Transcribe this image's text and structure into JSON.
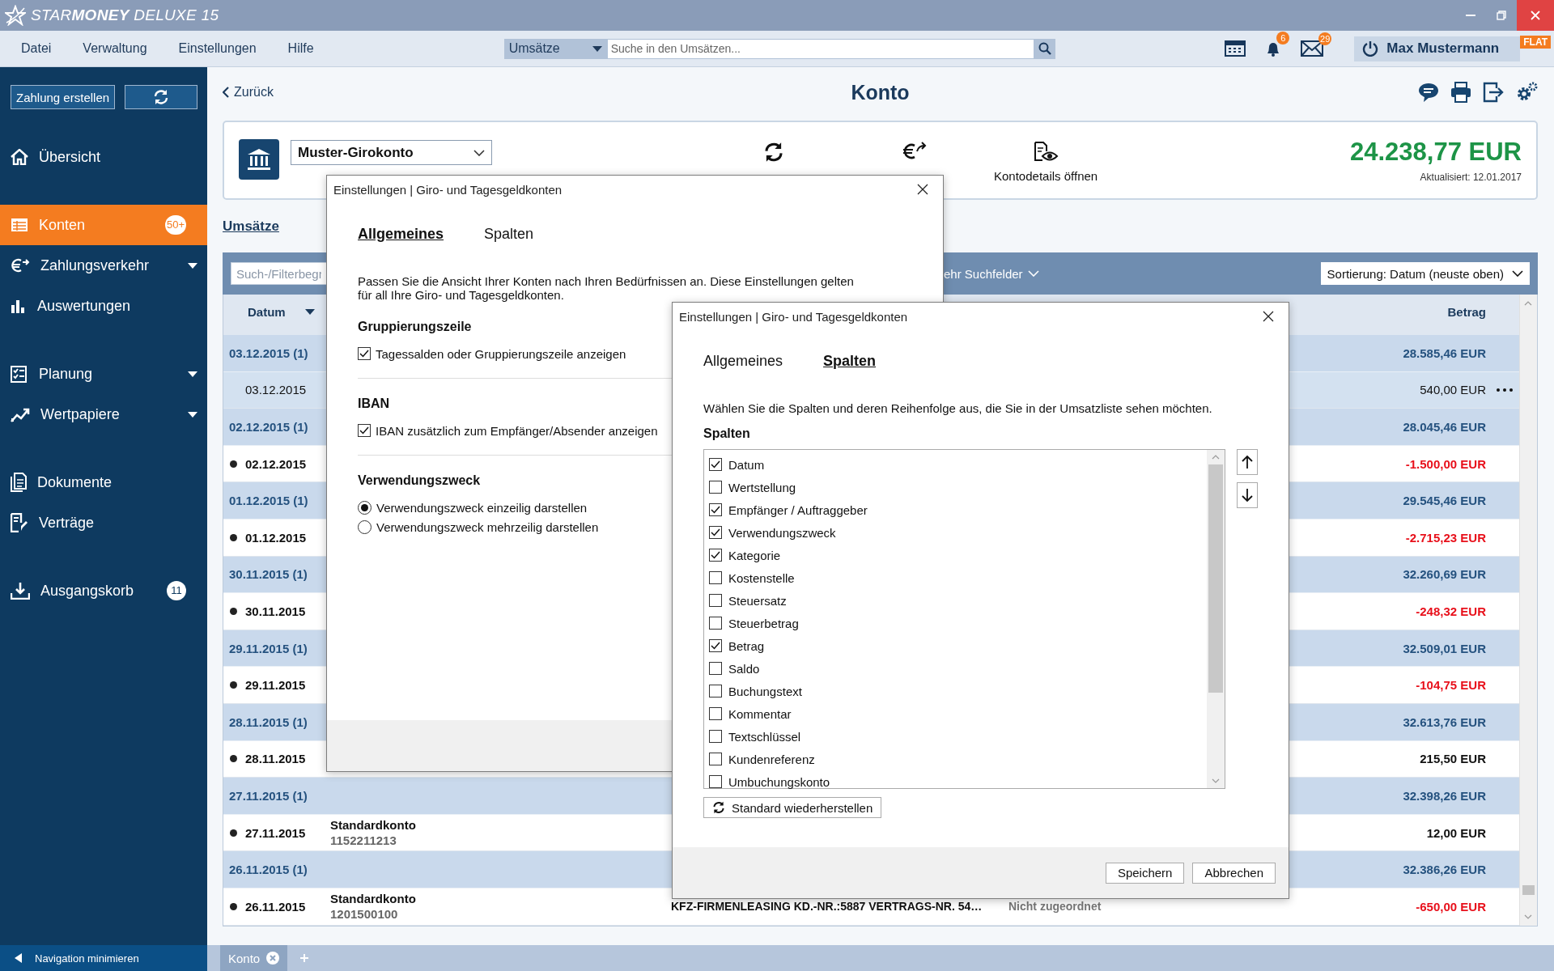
{
  "window": {
    "title": "STAR**MONEY** DELUXE 15"
  },
  "menu": [
    "Datei",
    "Verwaltung",
    "Einstellungen",
    "Hilfe"
  ],
  "search": {
    "scope": "Umsätze",
    "placeholder": "Suche in den Umsätzen..."
  },
  "notifications": {
    "count": "6"
  },
  "messages": {
    "count": "29"
  },
  "user": {
    "name": "Max Mustermann",
    "badge": "FLAT"
  },
  "sidebar": {
    "create_button": "Zahlung erstellen",
    "groups": [
      {
        "items": [
          {
            "label": "Übersicht",
            "selected": false,
            "expandable": false
          }
        ]
      },
      {
        "items": [
          {
            "label": "Konten",
            "selected": true,
            "expandable": false,
            "badge": "50+"
          },
          {
            "label": "Zahlungsverkehr",
            "selected": false,
            "expandable": true
          },
          {
            "label": "Auswertungen",
            "selected": false,
            "expandable": false
          }
        ]
      },
      {
        "items": [
          {
            "label": "Planung",
            "selected": false,
            "expandable": true
          },
          {
            "label": "Wertpapiere",
            "selected": false,
            "expandable": true
          }
        ]
      },
      {
        "items": [
          {
            "label": "Dokumente",
            "selected": false,
            "expandable": false
          },
          {
            "label": "Verträge",
            "selected": false,
            "expandable": false
          }
        ]
      },
      {
        "items": [
          {
            "label": "Ausgangskorb",
            "selected": false,
            "expandable": false,
            "badge": "11"
          }
        ]
      }
    ],
    "footer": "Navigation minimieren"
  },
  "page": {
    "back": "Zurück",
    "title": "Konto"
  },
  "account": {
    "name": "Muster-Girokonto",
    "action": "Kontodetails öffnen",
    "balance": "24.238,77 EUR",
    "updated": "Aktualisiert: 12.01.2017"
  },
  "tabs": [
    {
      "label": "Umsätze",
      "selected": true
    }
  ],
  "filter": {
    "placeholder": "Such-/Filterbegr",
    "more": "ehr Suchfelder",
    "sort": "Sortierung: Datum (neuste oben)"
  },
  "table": {
    "columns": [
      "Datum",
      "Betrag"
    ],
    "rows": [
      {
        "kind": "group",
        "label": "03.12.2015 (1)",
        "amount": "28.585,46 EUR"
      },
      {
        "kind": "item",
        "date": "03.12.2015",
        "amount": "540,00 EUR",
        "negative": false,
        "unread": false,
        "selected": true
      },
      {
        "kind": "group",
        "label": "02.12.2015 (1)",
        "amount": "28.045,46 EUR"
      },
      {
        "kind": "item",
        "date": "02.12.2015",
        "amount": "-1.500,00 EUR",
        "negative": true,
        "unread": true,
        "selected": false
      },
      {
        "kind": "group",
        "label": "01.12.2015 (1)",
        "amount": "29.545,46 EUR"
      },
      {
        "kind": "item",
        "date": "01.12.2015",
        "amount": "-2.715,23 EUR",
        "negative": true,
        "unread": true,
        "selected": false
      },
      {
        "kind": "group",
        "label": "30.11.2015 (1)",
        "amount": "32.260,69 EUR"
      },
      {
        "kind": "item",
        "date": "30.11.2015",
        "amount": "-248,32 EUR",
        "negative": true,
        "unread": true,
        "selected": false
      },
      {
        "kind": "group",
        "label": "29.11.2015 (1)",
        "amount": "32.509,01 EUR"
      },
      {
        "kind": "item",
        "date": "29.11.2015",
        "amount": "-104,75 EUR",
        "negative": true,
        "unread": true,
        "selected": false
      },
      {
        "kind": "group",
        "label": "28.11.2015 (1)",
        "amount": "32.613,76 EUR"
      },
      {
        "kind": "item",
        "date": "28.11.2015",
        "amount": "215,50 EUR",
        "negative": false,
        "unread": true,
        "selected": false
      },
      {
        "kind": "group",
        "label": "27.11.2015 (1)",
        "amount": "32.398,26 EUR"
      },
      {
        "kind": "item",
        "date": "27.11.2015",
        "account": "Standardkonto",
        "account_number": "1152211213",
        "amount": "12,00 EUR",
        "negative": false,
        "unread": true,
        "selected": false
      },
      {
        "kind": "group",
        "label": "26.11.2015 (1)",
        "amount": "32.386,26 EUR"
      },
      {
        "kind": "item",
        "date": "26.11.2015",
        "account": "Standardkonto",
        "account_number": "1201500100",
        "purpose": "KFZ-FIRMENLEASING KD.-NR.:5887 VERTRAGS-NR. 54…",
        "category": "Nicht zugeordnet",
        "amount": "-650,00 EUR",
        "negative": true,
        "unread": true,
        "selected": false
      }
    ]
  },
  "dialogs": [
    {
      "kind": "general",
      "title": "Einstellungen | Giro- und Tagesgeldkonten",
      "tabs": [
        {
          "label": "Allgemeines",
          "selected": true
        },
        {
          "label": "Spalten",
          "selected": false
        }
      ],
      "description": "Passen Sie die Ansicht Ihrer Konten nach Ihren Bedürfnissen an. Diese Einstellungen gelten für all Ihre Giro- und Tagesgeldkonten.",
      "sections": [
        {
          "heading": "Gruppierungszeile",
          "kind": "checkbox",
          "options": [
            {
              "label": "Tagessalden oder Gruppierungszeile anzeigen",
              "checked": true
            }
          ]
        },
        {
          "heading": "IBAN",
          "kind": "checkbox",
          "options": [
            {
              "label": "IBAN zusätzlich zum Empfänger/Absender anzeigen",
              "checked": true
            }
          ]
        },
        {
          "heading": "Verwendungszweck",
          "kind": "radio",
          "options": [
            {
              "label": "Verwendungszweck einzeilig darstellen",
              "selected": true
            },
            {
              "label": "Verwendungszweck mehrzeilig darstellen",
              "selected": false
            }
          ]
        }
      ]
    },
    {
      "kind": "columns",
      "title": "Einstellungen | Giro- und Tagesgeldkonten",
      "tabs": [
        {
          "label": "Allgemeines",
          "selected": false
        },
        {
          "label": "Spalten",
          "selected": true
        }
      ],
      "description": "Wählen Sie die Spalten und deren Reihenfolge aus, die Sie in der Umsatzliste sehen möchten.",
      "list_heading": "Spalten",
      "columns": [
        {
          "label": "Datum",
          "checked": true
        },
        {
          "label": "Wertstellung",
          "checked": false
        },
        {
          "label": "Empfänger / Auftraggeber",
          "checked": true
        },
        {
          "label": "Verwendungszweck",
          "checked": true
        },
        {
          "label": "Kategorie",
          "checked": true
        },
        {
          "label": "Kostenstelle",
          "checked": false
        },
        {
          "label": "Steuersatz",
          "checked": false
        },
        {
          "label": "Steuerbetrag",
          "checked": false
        },
        {
          "label": "Betrag",
          "checked": true
        },
        {
          "label": "Saldo",
          "checked": false
        },
        {
          "label": "Buchungstext",
          "checked": false
        },
        {
          "label": "Kommentar",
          "checked": false
        },
        {
          "label": "Textschlüssel",
          "checked": false
        },
        {
          "label": "Kundenreferenz",
          "checked": false
        },
        {
          "label": "Umbuchungskonto",
          "checked": false
        }
      ],
      "restore_button": "Standard wiederherstellen",
      "buttons": [
        "Speichern",
        "Abbrechen"
      ]
    }
  ],
  "bottom_tabs": [
    {
      "label": "Konto",
      "selected": true
    }
  ]
}
